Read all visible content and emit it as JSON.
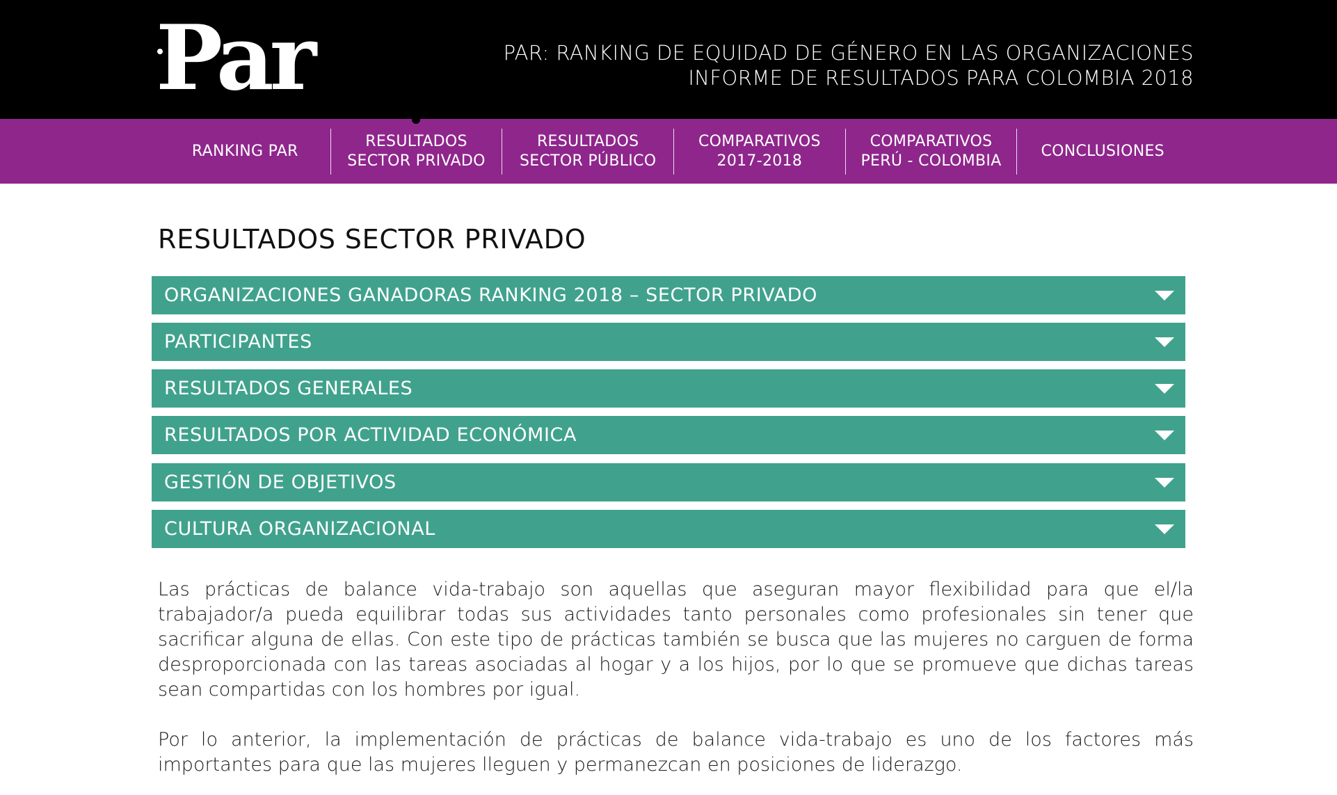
{
  "header": {
    "logo_text": "Par",
    "title_line1": "PAR: RANKING DE EQUIDAD DE GÉNERO EN LAS ORGANIZACIONES",
    "title_line2": "INFORME DE RESULTADOS PARA COLOMBIA 2018",
    "colors": {
      "background": "#000000",
      "text": "#ffffff"
    }
  },
  "nav": {
    "color": "#8f268c",
    "items": [
      {
        "label": "RANKING PAR"
      },
      {
        "label": "RESULTADOS\nSECTOR PRIVADO"
      },
      {
        "label": "RESULTADOS\nSECTOR PÚBLICO"
      },
      {
        "label": "COMPARATIVOS\n2017-2018"
      },
      {
        "label": "COMPARATIVOS\nPERÚ - COLOMBIA"
      },
      {
        "label": "CONCLUSIONES"
      }
    ]
  },
  "main": {
    "title": "RESULTADOS SECTOR PRIVADO",
    "accordion_color": "#40a28d",
    "accordion": [
      {
        "label": "ORGANIZACIONES GANADORAS RANKING 2018 – SECTOR PRIVADO",
        "icon": "triangle-down-icon"
      },
      {
        "label": "PARTICIPANTES",
        "icon": "triangle-down-icon"
      },
      {
        "label": "RESULTADOS GENERALES",
        "icon": "triangle-down-icon"
      },
      {
        "label": "RESULTADOS POR ACTIVIDAD ECONÓMICA",
        "icon": "triangle-down-icon"
      },
      {
        "label": "GESTIÓN DE OBJETIVOS",
        "icon": "triangle-down-icon"
      },
      {
        "label": "CULTURA ORGANIZACIONAL",
        "icon": "triangle-down-icon"
      }
    ],
    "paragraphs": [
      "Las prácticas de balance vida-trabajo son aquellas que aseguran mayor flexibilidad para que el/la trabajador/a pueda equilibrar todas sus actividades tanto personales como profesionales sin tener que sacrificar alguna de ellas. Con este tipo de prácticas también se busca que las mujeres no carguen de forma desproporcionada con las tareas asociadas al hogar y a los hijos, por lo que se promueve que dichas tareas sean compartidas con los hombres por igual.",
      "Por lo anterior, la implementación de prácticas de balance vida-trabajo es uno de los factores más importantes para que las mujeres lleguen y permanezcan en posiciones de liderazgo."
    ]
  }
}
